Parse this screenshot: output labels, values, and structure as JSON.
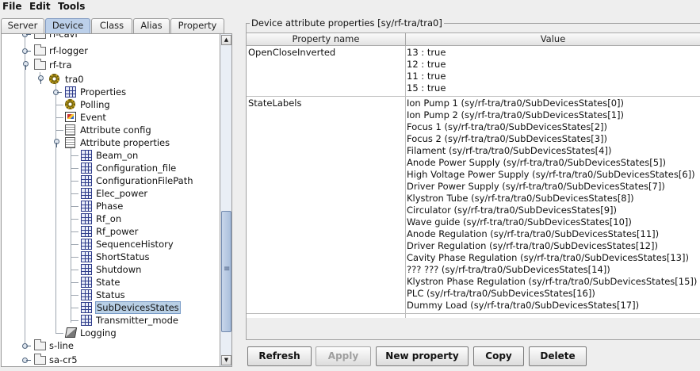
{
  "menu": {
    "file": "File",
    "edit": "Edit",
    "tools": "Tools"
  },
  "tabs": [
    "Server",
    "Device",
    "Class",
    "Alias",
    "Property"
  ],
  "active_tab": "Device",
  "tree": {
    "top_partial": "rf-cavi",
    "rf_logger": "rf-logger",
    "rf_tra": "rf-tra",
    "tra0": "tra0",
    "properties": "Properties",
    "polling": "Polling",
    "event": "Event",
    "attribute_config": "Attribute config",
    "attribute_properties": "Attribute properties",
    "attributes": [
      "Beam_on",
      "Configuration_file",
      "ConfigurationFilePath",
      "Elec_power",
      "Phase",
      "Rf_on",
      "Rf_power",
      "SequenceHistory",
      "ShortStatus",
      "Shutdown",
      "State",
      "Status",
      "SubDevicesStates",
      "Transmitter_mode"
    ],
    "selected_attribute": "SubDevicesStates",
    "logging": "Logging",
    "s_line": "s-line",
    "sa_cr5": "sa-cr5"
  },
  "panel": {
    "title": "Device attribute properties [sy/rf-tra/tra0]",
    "col_name": "Property name",
    "col_value": "Value",
    "rows": [
      {
        "name": "OpenCloseInverted",
        "values": [
          "13 : true",
          "12 : true",
          "11 : true",
          "15 : true"
        ]
      },
      {
        "name": "StateLabels",
        "values": [
          "Ion Pump 1 (sy/rf-tra/tra0/SubDevicesStates[0])",
          "Ion Pump 2 (sy/rf-tra/tra0/SubDevicesStates[1])",
          "Focus 1 (sy/rf-tra/tra0/SubDevicesStates[2])",
          "Focus 2 (sy/rf-tra/tra0/SubDevicesStates[3])",
          "Filament (sy/rf-tra/tra0/SubDevicesStates[4])",
          "Anode Power Supply  (sy/rf-tra/tra0/SubDevicesStates[5])",
          "High Voltage Power Supply (sy/rf-tra/tra0/SubDevicesStates[6])",
          "Driver Power Supply (sy/rf-tra/tra0/SubDevicesStates[7])",
          "Klystron Tube (sy/rf-tra/tra0/SubDevicesStates[8])",
          "Circulator (sy/rf-tra/tra0/SubDevicesStates[9])",
          "Wave guide (sy/rf-tra/tra0/SubDevicesStates[10])",
          "Anode Regulation (sy/rf-tra/tra0/SubDevicesStates[11])",
          "Driver Regulation (sy/rf-tra/tra0/SubDevicesStates[12])",
          "Cavity Phase Regulation (sy/rf-tra/tra0/SubDevicesStates[13])",
          "??? ??? (sy/rf-tra/tra0/SubDevicesStates[14])",
          "Klystron Phase Regulation (sy/rf-tra/tra0/SubDevicesStates[15])",
          "PLC (sy/rf-tra/tra0/SubDevicesStates[16])",
          "Dummy Load (sy/rf-tra/tra0/SubDevicesStates[17])"
        ]
      }
    ]
  },
  "buttons": {
    "refresh": "Refresh",
    "apply": "Apply",
    "new_property": "New property",
    "copy": "Copy",
    "delete": "Delete"
  },
  "colors": {
    "selection": "#b8cfe5",
    "active_tab": "#bcd0ea"
  }
}
